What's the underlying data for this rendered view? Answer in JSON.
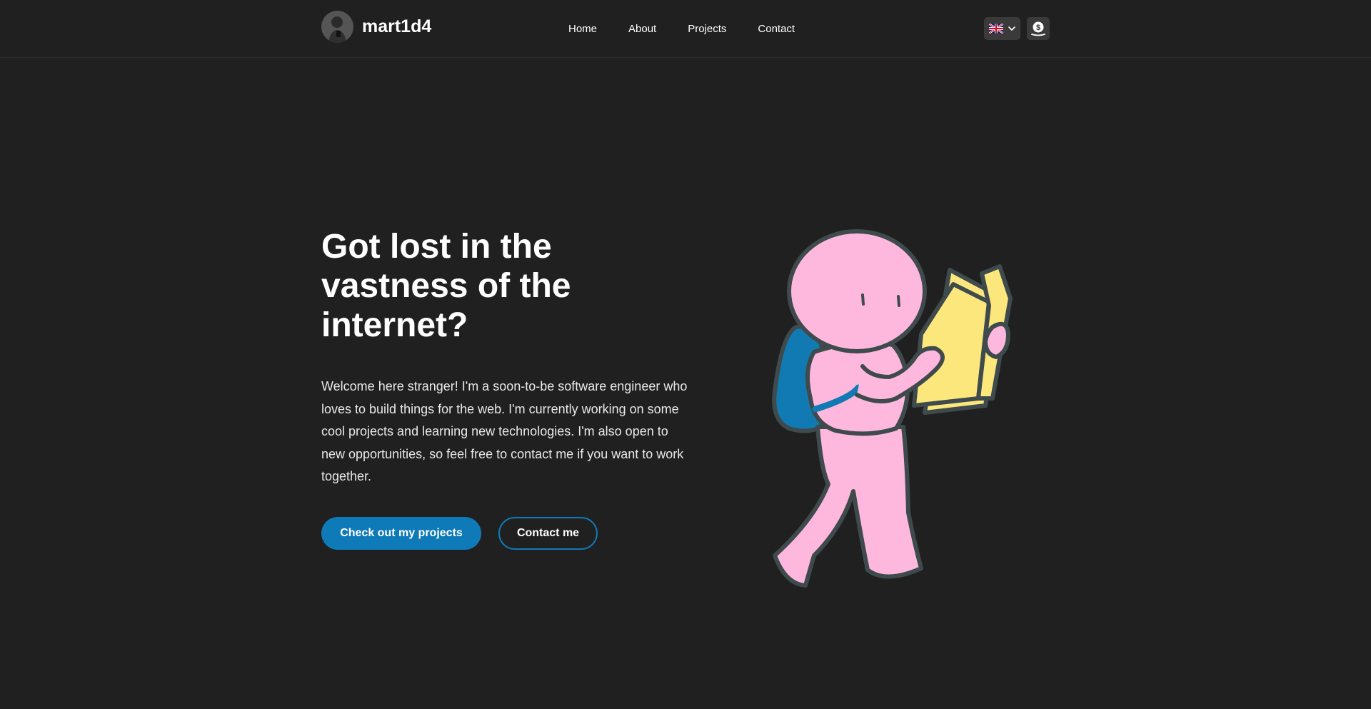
{
  "nav": {
    "brand_name": "mart1d4",
    "links": [
      {
        "label": "Home"
      },
      {
        "label": "About"
      },
      {
        "label": "Projects"
      },
      {
        "label": "Contact"
      }
    ],
    "language_icon": "uk-flag-icon",
    "theme_icon": "coin-theme-icon"
  },
  "hero": {
    "title": "Got lost in the vastness of the internet?",
    "description": "Welcome here stranger! I'm a soon-to-be software engineer who loves to build things for the web. I'm currently working on some cool projects and learning new technologies. I'm also open to new opportunities, so feel free to contact me if you want to work together.",
    "primary_button": "Check out my projects",
    "secondary_button": "Contact me"
  },
  "colors": {
    "background": "#202020",
    "accent": "#0f7ab8",
    "character_pink": "#ffb8dd",
    "map_yellow": "#fce77c",
    "backpack_blue": "#127ab3",
    "outline": "#3f4a4d"
  }
}
